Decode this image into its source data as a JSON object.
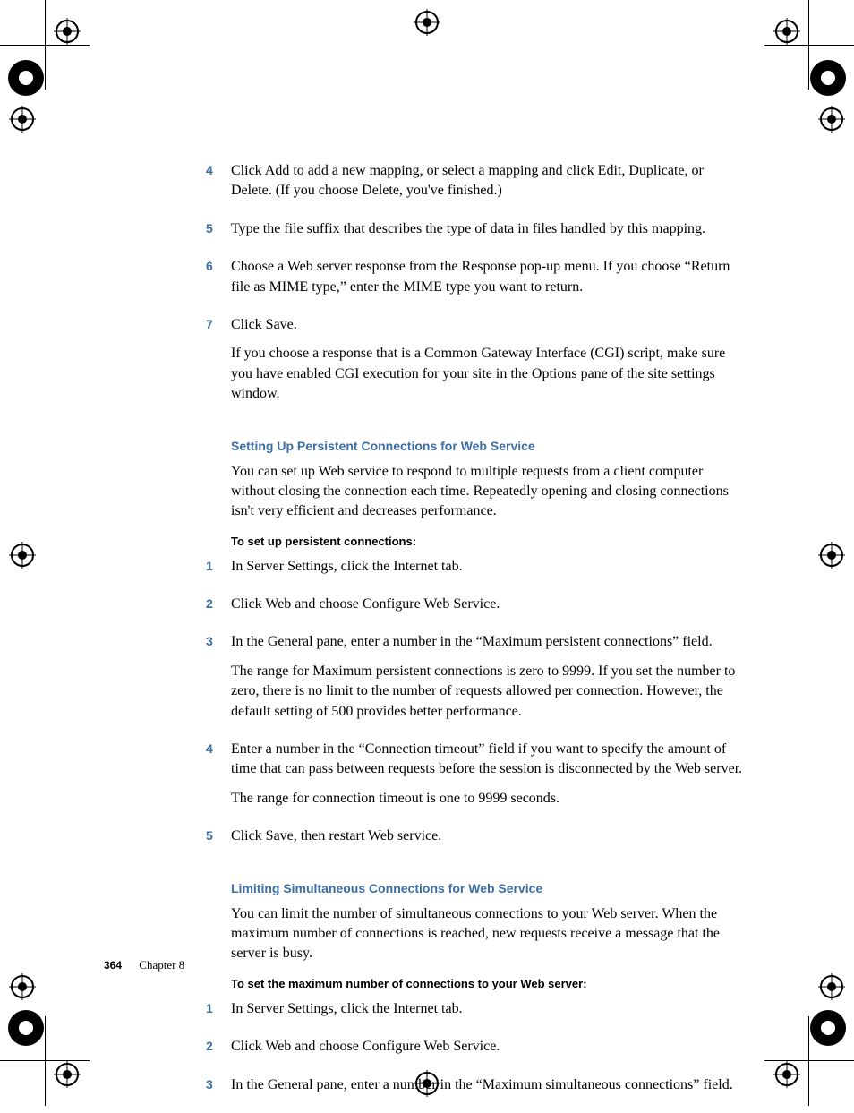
{
  "steps_top": [
    {
      "num": "4",
      "text": "Click Add to add a new mapping, or select a mapping and click Edit, Duplicate, or Delete. (If you choose Delete, you've finished.)"
    },
    {
      "num": "5",
      "text": "Type the file suffix that describes the type of data in files handled by this mapping."
    },
    {
      "num": "6",
      "text": "Choose a Web server response from the Response pop-up menu. If you choose “Return file as MIME type,” enter the MIME type you want to return."
    },
    {
      "num": "7",
      "text": "Click Save.",
      "extra": "If you choose a response that is a Common Gateway Interface (CGI) script, make sure you have enabled CGI execution for your site in the Options pane of the site settings window."
    }
  ],
  "section1": {
    "title": "Setting Up Persistent Connections for Web Service",
    "intro": "You can set up Web service to respond to multiple requests from a client computer without closing the connection each time. Repeatedly opening and closing connections isn't very efficient and decreases performance.",
    "subhead": "To set up persistent connections:",
    "steps": [
      {
        "num": "1",
        "text": "In Server Settings, click the Internet tab."
      },
      {
        "num": "2",
        "text": "Click Web and choose Configure Web Service."
      },
      {
        "num": "3",
        "text": "In the General pane, enter a number in the “Maximum persistent connections” field.",
        "extra": "The range for Maximum persistent connections is zero to 9999. If you set the number to zero, there is no limit to the number of requests allowed per connection. However, the default setting of 500 provides better performance."
      },
      {
        "num": "4",
        "text": "Enter a number in the “Connection timeout” field if you want to specify the amount of time that can pass between requests before the session is disconnected by the Web server.",
        "extra": "The range for connection timeout is one to 9999 seconds."
      },
      {
        "num": "5",
        "text": "Click Save, then restart Web service."
      }
    ]
  },
  "section2": {
    "title": "Limiting Simultaneous Connections for Web Service",
    "intro": "You can limit the number of simultaneous connections to your Web server. When the maximum number of connections is reached, new requests receive a message that the server is busy.",
    "subhead": "To set the maximum number of connections to your Web server:",
    "steps": [
      {
        "num": "1",
        "text": "In Server Settings, click the Internet tab."
      },
      {
        "num": "2",
        "text": "Click Web and choose Configure Web Service."
      },
      {
        "num": "3",
        "text": "In the General pane, enter a number in the “Maximum simultaneous connections” field."
      }
    ]
  },
  "footer": {
    "page": "364",
    "chapter": "Chapter 8"
  }
}
